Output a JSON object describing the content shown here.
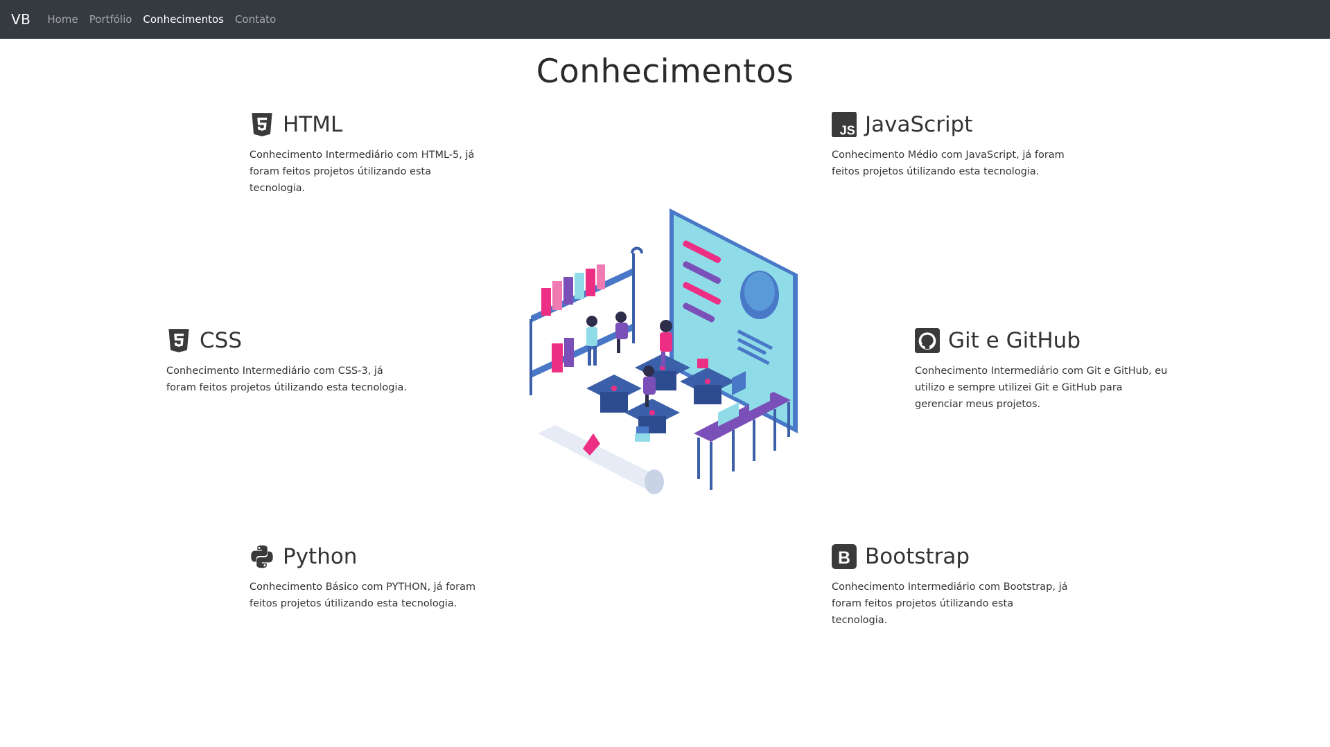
{
  "nav": {
    "brand": "VB",
    "links": [
      {
        "label": "Home",
        "active": false
      },
      {
        "label": "Portfólio",
        "active": false
      },
      {
        "label": "Conhecimentos",
        "active": true
      },
      {
        "label": "Contato",
        "active": false
      }
    ]
  },
  "page": {
    "title": "Conhecimentos"
  },
  "skills": {
    "html": {
      "title": "HTML",
      "icon": "html5-icon",
      "description": "Conhecimento Intermediário com HTML-5, já foram feitos projetos útilizando esta tecnologia."
    },
    "javascript": {
      "title": "JavaScript",
      "icon": "javascript-icon",
      "description": "Conhecimento Médio com JavaScript, já foram feitos projetos útilizando esta tecnologia."
    },
    "css": {
      "title": "CSS",
      "icon": "css3-icon",
      "description": "Conhecimento Intermediário com CSS-3, já foram feitos projetos útilizando esta tecnologia."
    },
    "git": {
      "title": "Git e GitHub",
      "icon": "github-icon",
      "description": "Conhecimento Intermediário com Git e GitHub, eu utilizo e sempre utilizei Git e GitHub para gerenciar meus projetos."
    },
    "python": {
      "title": "Python",
      "icon": "python-icon",
      "description": "Conhecimento Básico com PYTHON, já foram feitos projetos útilizando esta tecnologia."
    },
    "bootstrap": {
      "title": "Bootstrap",
      "icon": "bootstrap-icon",
      "description": "Conhecimento Intermediário com Bootstrap, já foram feitos projetos útilizando esta tecnologia."
    }
  },
  "colors": {
    "navbar": "#343a40",
    "icon": "#3a3a3a",
    "accent_pink": "#ec2f84",
    "accent_purple": "#7a4fb8",
    "accent_blue": "#4a78c8",
    "screen": "#8fdce8"
  }
}
